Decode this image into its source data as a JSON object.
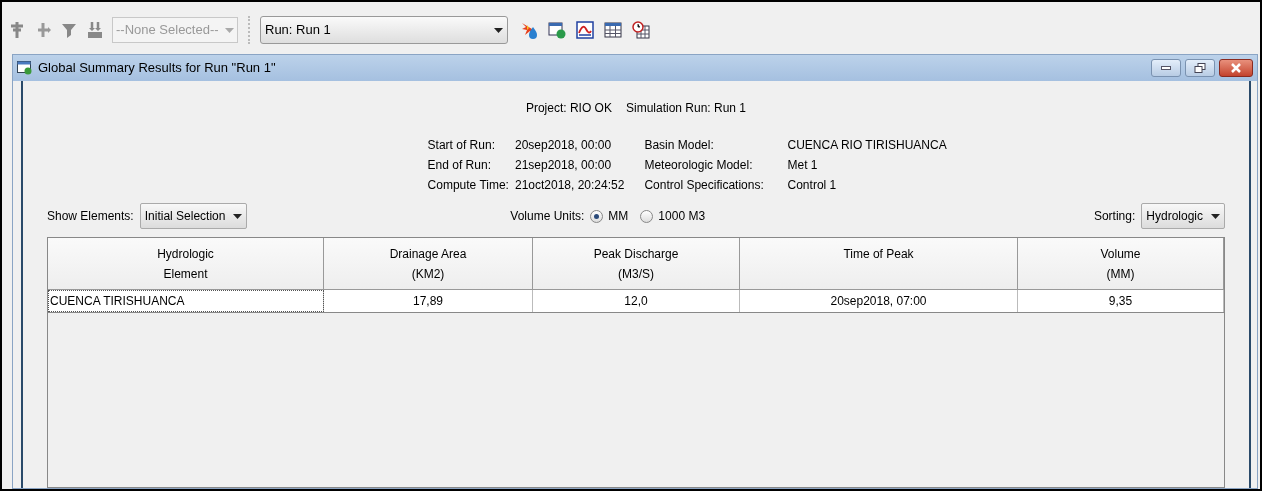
{
  "toolbar": {
    "element_select": {
      "placeholder": "--None Selected--"
    },
    "run_select": {
      "value": "Run: Run 1"
    }
  },
  "window": {
    "title": "Global Summary Results for Run \"Run 1\""
  },
  "summary": {
    "project": "Project: RIO OK",
    "simulation_run": "Simulation Run: Run 1",
    "left": [
      {
        "label": "Start of Run:",
        "value": "20sep2018, 00:00"
      },
      {
        "label": "End of Run:",
        "value": "21sep2018, 00:00"
      },
      {
        "label": "Compute Time:",
        "value": "21oct2018, 20:24:52"
      }
    ],
    "right": [
      {
        "label": "Basin Model:",
        "value": "CUENCA RIO TIRISHUANCA"
      },
      {
        "label": "Meteorologic Model:",
        "value": "Met 1"
      },
      {
        "label": "Control Specifications:",
        "value": "Control 1"
      }
    ]
  },
  "controls": {
    "show_elements": {
      "label": "Show Elements:",
      "value": "Initial Selection"
    },
    "volume_units": {
      "label": "Volume Units:",
      "options": [
        {
          "label": "MM",
          "selected": true
        },
        {
          "label": "1000 M3",
          "selected": false
        }
      ]
    },
    "sorting": {
      "label": "Sorting:",
      "value": "Hydrologic"
    }
  },
  "table": {
    "columns": [
      "Hydrologic\nElement",
      "Drainage Area\n(KM2)",
      "Peak Discharge\n(M3/S)",
      "Time of Peak",
      "Volume\n(MM)"
    ],
    "rows": [
      [
        "CUENCA TIRISHUANCA",
        "17,89",
        "12,0",
        "20sep2018, 07:00",
        "9,35"
      ]
    ]
  }
}
